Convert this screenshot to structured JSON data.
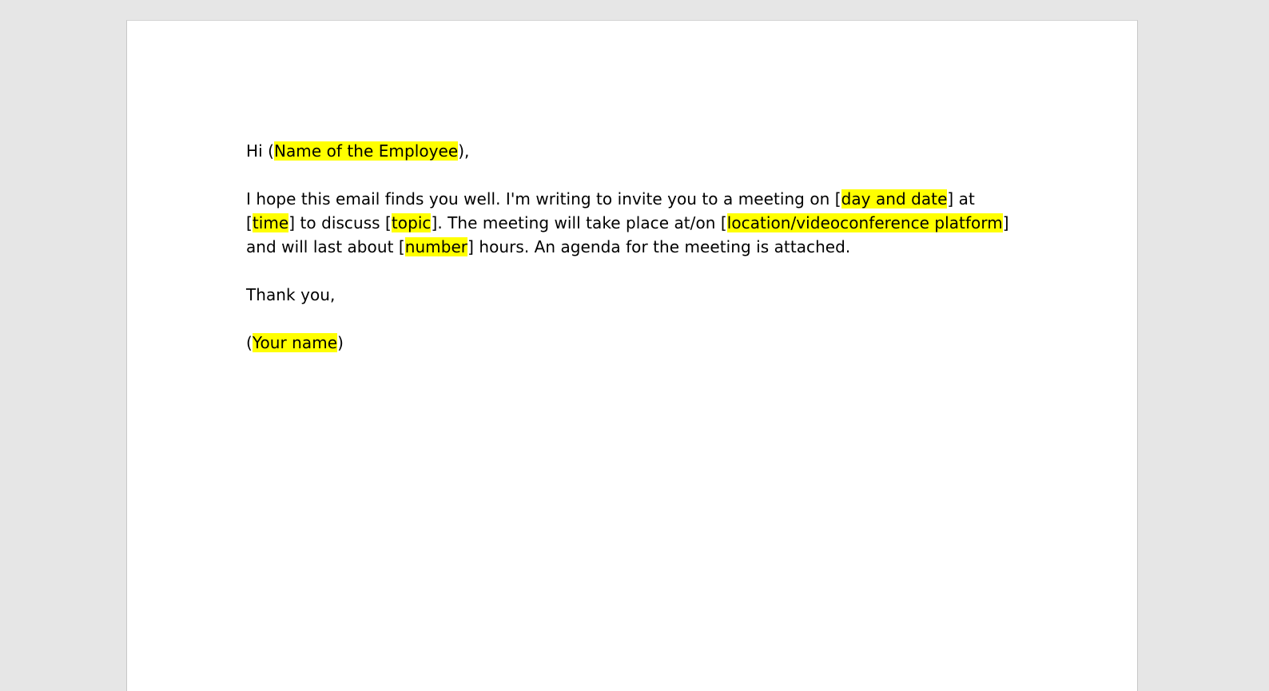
{
  "document": {
    "greeting": {
      "prefix": "Hi (",
      "name_placeholder": "Name of the Employee",
      "suffix": "),"
    },
    "body": {
      "line1_text": "I hope this email finds you well. I'm writing to invite you to a meeting on [",
      "day_date_placeholder": "day and date",
      "line1_end": "] at",
      "line2_open": "[",
      "time_placeholder": "time",
      "line2_mid1": "] to discuss [",
      "topic_placeholder": "topic",
      "line2_mid2": "]. The meeting will take place at/on [",
      "location_placeholder": "location/videoconference platform",
      "line2_end": "]",
      "line3_start": "and will last about [",
      "number_placeholder": "number",
      "line3_end": "] hours. An agenda for the meeting is attached."
    },
    "closing": "Thank you,",
    "signature": {
      "prefix": "(",
      "name_placeholder": "Your name",
      "suffix": ")"
    },
    "highlight_color": "#ffff00",
    "background_color": "#e6e6e6"
  }
}
